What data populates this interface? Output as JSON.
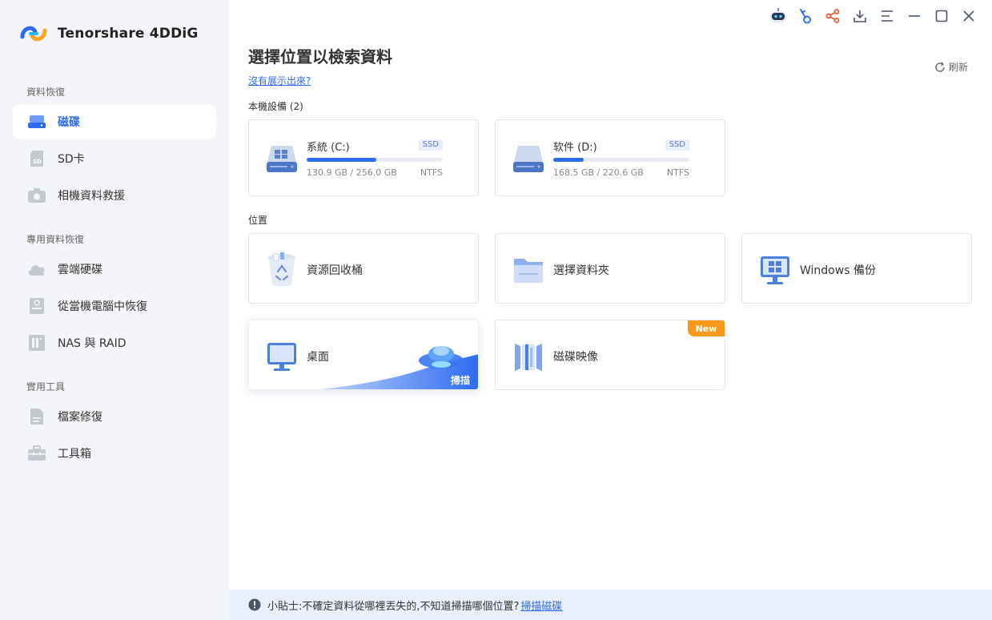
{
  "app": {
    "name": "Tenorshare 4DDiG"
  },
  "sidebar": {
    "sections": [
      {
        "title": "資料恢復",
        "items": [
          {
            "label": "磁碟",
            "icon": "hard-drive-icon",
            "active": true
          },
          {
            "label": "SD卡",
            "icon": "sd-card-icon"
          },
          {
            "label": "相機資料救援",
            "icon": "camera-icon"
          }
        ]
      },
      {
        "title": "專用資料恢復",
        "items": [
          {
            "label": "雲端硬碟",
            "icon": "cloud-icon"
          },
          {
            "label": "從當機電腦中恢復",
            "icon": "crashed-computer-icon"
          },
          {
            "label": "NAS 與 RAID",
            "icon": "nas-icon"
          }
        ]
      },
      {
        "title": "實用工具",
        "items": [
          {
            "label": "檔案修復",
            "icon": "file-repair-icon"
          },
          {
            "label": "工具箱",
            "icon": "toolbox-icon"
          }
        ]
      }
    ]
  },
  "header": {
    "title": "選擇位置以檢索資料",
    "help_link": "沒有展示出來?",
    "refresh_label": "刷新"
  },
  "local_devices": {
    "title": "本機設備 (2)",
    "disks": [
      {
        "name": "系統 (C:)",
        "type": "SSD",
        "usage": "130.9 GB / 256.0 GB",
        "fs": "NTFS",
        "used_fraction": 0.511
      },
      {
        "name": "软件 (D:)",
        "type": "SSD",
        "usage": "168.5 GB / 220.6 GB",
        "fs": "NTFS",
        "used_fraction": 0.224
      }
    ]
  },
  "locations": {
    "title": "位置",
    "items": [
      {
        "label": "資源回收桶",
        "icon": "recycle-bin-icon"
      },
      {
        "label": "選擇資料夾",
        "icon": "folder-icon"
      },
      {
        "label": "Windows 備份",
        "icon": "windows-backup-icon"
      },
      {
        "label": "桌面",
        "icon": "desktop-icon",
        "tag": "掃描"
      },
      {
        "label": "磁碟映像",
        "icon": "disk-image-icon",
        "badge": "New"
      }
    ]
  },
  "tip": {
    "text": "小貼士:不確定資料從哪裡丟失的,不知道掃描哪個位置?",
    "link": "掃描磁碟"
  },
  "colors": {
    "accent": "#2e6bf2",
    "sidebar_bg": "#f4f5f8",
    "tip_bg": "#eaf0fb",
    "badge_new": "#f79a1c"
  }
}
